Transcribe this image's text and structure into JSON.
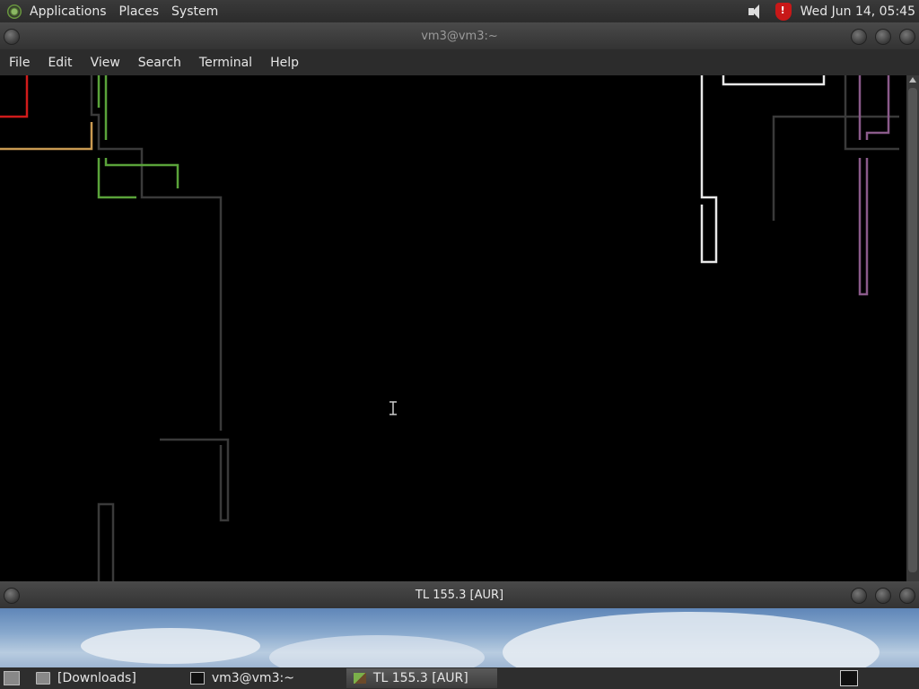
{
  "top_panel": {
    "menus": [
      "Applications",
      "Places",
      "System"
    ],
    "clock": "Wed Jun 14, 05:45"
  },
  "terminal_window": {
    "title": "vm3@vm3:~",
    "menu": [
      "File",
      "Edit",
      "View",
      "Search",
      "Terminal",
      "Help"
    ]
  },
  "game_window": {
    "title": "TL 155.3 [AUR]"
  },
  "taskbar": {
    "tasks": [
      {
        "label": "[Downloads]",
        "icon": "folder-icon"
      },
      {
        "label": "vm3@vm3:~",
        "icon": "terminal-icon"
      },
      {
        "label": "TL 155.3 [AUR]",
        "icon": "game-icon"
      }
    ]
  },
  "colors": {
    "red": "#d01b1b",
    "orange": "#c99a52",
    "green": "#5aa33a",
    "gray": "#3a3a3a",
    "white": "#e8e8e8",
    "purple": "#8a5a8a",
    "panel": "#2e2e2e"
  }
}
